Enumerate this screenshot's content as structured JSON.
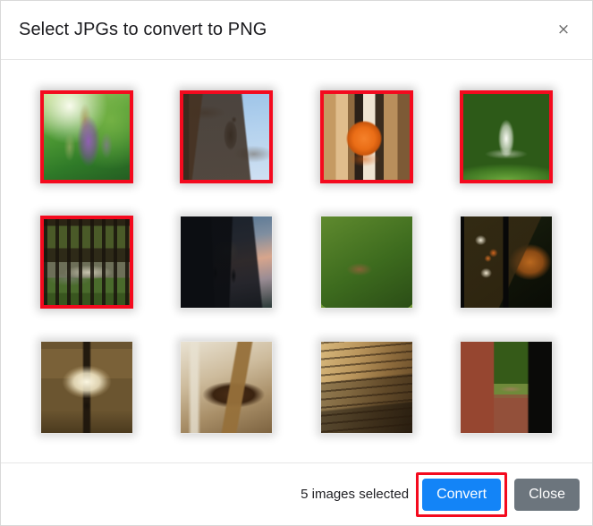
{
  "dialog": {
    "title": "Select JPGs to convert to PNG",
    "close_icon": "close-x-icon",
    "close_label": "×"
  },
  "gallery": {
    "columns": 4,
    "rows": 3,
    "selected_border_color": "#f40a1e",
    "thumbnails": [
      {
        "index": 1,
        "name": "purple-flower-thumbnail",
        "alt": "Purple vitex flower spike against green bokeh",
        "selected": true,
        "art": "art-flower"
      },
      {
        "index": 2,
        "name": "cormorant-bird-thumbnail",
        "alt": "Cormorant perched in bare trees against blue sky",
        "selected": true,
        "art": "art-bird"
      },
      {
        "index": 3,
        "name": "orange-fruit-thumbnail",
        "alt": "Orange on a reflective surface in a blurred warm interior",
        "selected": true,
        "art": "art-orange"
      },
      {
        "index": 4,
        "name": "pond-fountain-thumbnail",
        "alt": "Water fountain in a pond surrounded by green grass",
        "selected": true,
        "art": "art-fountain"
      },
      {
        "index": 5,
        "name": "forest-pond-thumbnail",
        "alt": "Bare forest trees beside a shallow pond",
        "selected": true,
        "art": "art-forest"
      },
      {
        "index": 6,
        "name": "sunset-trees-thumbnail",
        "alt": "Sun setting through bare trees with reed silhouettes",
        "selected": false,
        "art": "art-sunset"
      },
      {
        "index": 7,
        "name": "grass-closeup-thumbnail",
        "alt": "Close-up of green grass blades and a dry leaf",
        "selected": false,
        "art": "art-grass"
      },
      {
        "index": 8,
        "name": "food-plate-thumbnail",
        "alt": "Plate of grilled salmon with asparagus and vegetables",
        "selected": false,
        "art": "art-food"
      },
      {
        "index": 9,
        "name": "ceiling-lamp-thumbnail",
        "alt": "Glowing glass ceiling lamp shade",
        "selected": false,
        "art": "art-lamp"
      },
      {
        "index": 10,
        "name": "wooden-chair-thumbnail",
        "alt": "Close-up of a wooden chair or stool joint",
        "selected": false,
        "art": "art-chair"
      },
      {
        "index": 11,
        "name": "stacked-books-thumbnail",
        "alt": "Edges of stacked books or paper",
        "selected": false,
        "art": "art-books"
      },
      {
        "index": 12,
        "name": "lizard-brick-thumbnail",
        "alt": "Lizard on a red brick ledge with green background",
        "selected": false,
        "art": "art-lizard"
      }
    ]
  },
  "footer": {
    "selection_status": "5 images selected",
    "convert_label": "Convert",
    "close_label": "Close",
    "convert_color": "#1384f7",
    "close_color": "#6c757d",
    "highlight_color": "#f40a1e"
  }
}
